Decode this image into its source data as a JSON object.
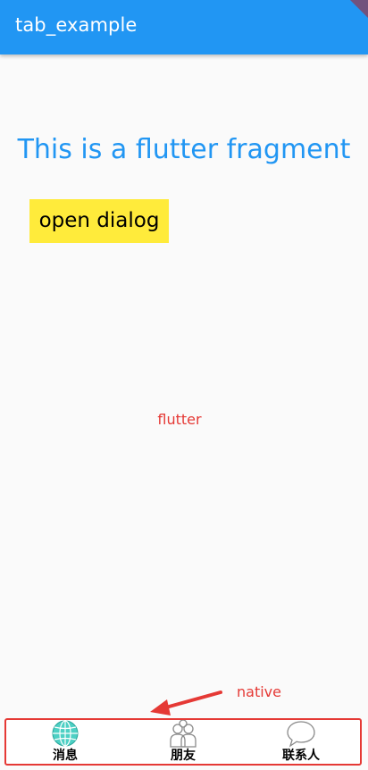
{
  "appbar": {
    "title": "tab_example"
  },
  "main": {
    "headline": "This is a flutter fragment",
    "open_dialog_label": "open dialog",
    "flutter_label": "flutter"
  },
  "annotation": {
    "native_label": "native"
  },
  "bottom_nav": {
    "items": [
      {
        "label": "消息",
        "icon": "globe-icon",
        "active": true
      },
      {
        "label": "朋友",
        "icon": "people-icon",
        "active": false
      },
      {
        "label": "联系人",
        "icon": "chat-bubble-icon",
        "active": false
      }
    ]
  },
  "colors": {
    "primary": "#2196f3",
    "button_bg": "#ffeb3b",
    "annotation_red": "#e53935",
    "active_icon": "#4dd0c4"
  }
}
